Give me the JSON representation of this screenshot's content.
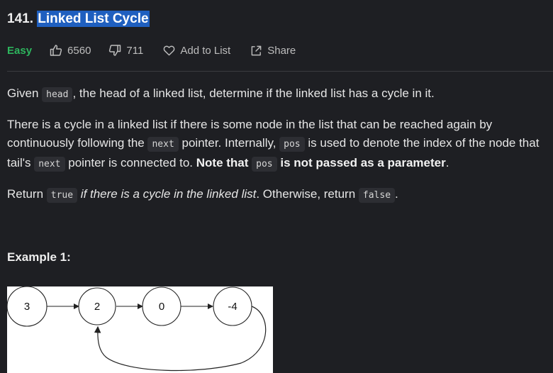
{
  "problem": {
    "number": "141.",
    "title": "Linked List Cycle"
  },
  "meta": {
    "difficulty": "Easy",
    "likes": "6560",
    "dislikes": "711",
    "add_to_list": "Add to List",
    "share": "Share",
    "difficulty_color": "#2db55d"
  },
  "description": {
    "p1": {
      "a": "Given ",
      "code_head": "head",
      "b": ", the head of a linked list, determine if the linked list has a cycle in it."
    },
    "p2": {
      "a": "There is a cycle in a linked list if there is some node in the list that can be reached again by continuously following the ",
      "code_next1": "next",
      "b": " pointer. Internally, ",
      "code_pos1": "pos",
      "c": " is used to denote the index of the node that tail's ",
      "code_next2": "next",
      "d": " pointer is connected to. ",
      "bold1": "Note that ",
      "code_pos2": "pos",
      "bold2": " is not passed as a parameter",
      "e": "."
    },
    "p3": {
      "a": "Return ",
      "code_true": "true",
      "italic": " if there is a cycle in the linked list",
      "b": ". Otherwise, return ",
      "code_false": "false",
      "c": "."
    }
  },
  "example": {
    "title": "Example 1:",
    "nodes": [
      "3",
      "2",
      "0",
      "-4"
    ]
  }
}
